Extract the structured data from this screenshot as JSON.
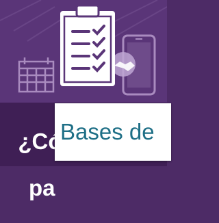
{
  "banner": {
    "icons": [
      "calendar-icon",
      "checklist-clipboard-icon",
      "handshake-icon",
      "smartphone-icon"
    ]
  },
  "heading": {
    "line1": "¿Có",
    "line2": "pa"
  },
  "tooltip": {
    "text": "Bases de"
  }
}
